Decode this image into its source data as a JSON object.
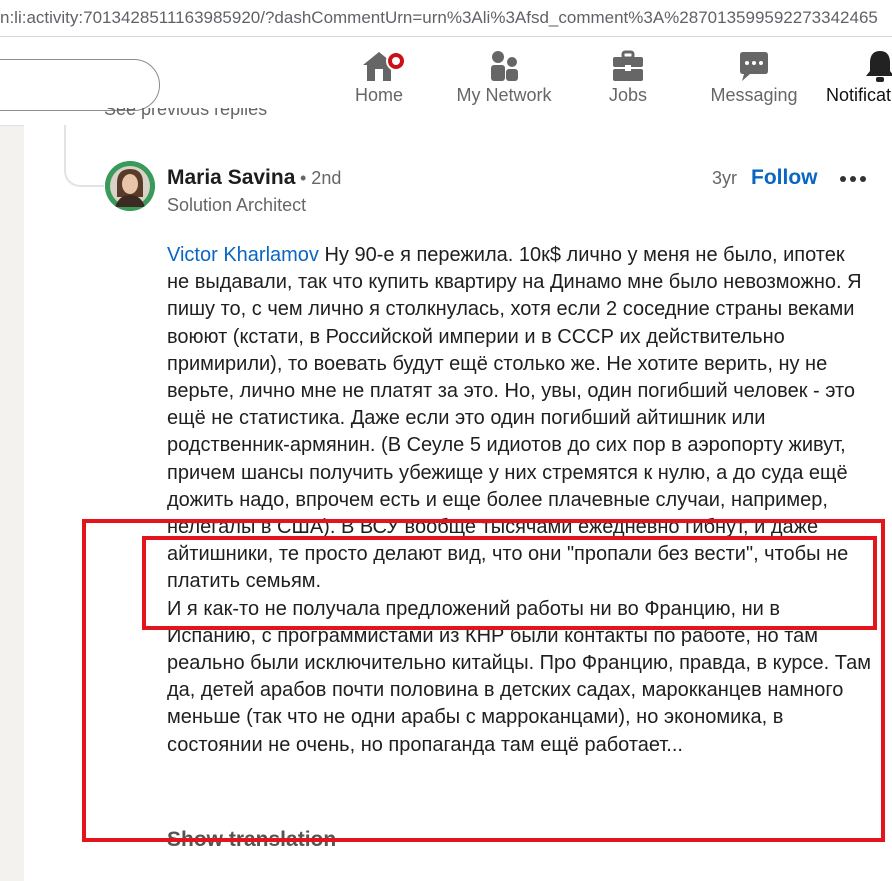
{
  "browser": {
    "url": "n:li:activity:7013428511163985920/?dashCommentUrn=urn%3Ali%3Afsd_comment%3A%287013599592273342465"
  },
  "nav": {
    "items": [
      {
        "label": "Home",
        "icon": "home-icon"
      },
      {
        "label": "My Network",
        "icon": "network-icon"
      },
      {
        "label": "Jobs",
        "icon": "briefcase-icon"
      },
      {
        "label": "Messaging",
        "icon": "messaging-icon"
      },
      {
        "label": "Notificat",
        "icon": "bell-icon"
      }
    ],
    "badge_color": "#cc1016"
  },
  "thread": {
    "see_previous": "See previous replies"
  },
  "comment": {
    "author": "Maria Savina",
    "degree": "• 2nd",
    "headline": "Solution Architect",
    "time": "3yr",
    "follow_label": "Follow",
    "more_icon": "more-icon",
    "mention": "Victor Kharlamov",
    "paragraph1": " Ну 90-е я пережила. 10к$ лично у меня не было, ипотек не выдавали, так что купить квартиру на Динамо мне было невозможно.  Я пишу то, с чем лично я столкнулась, хотя если 2 соседние страны веками воюют (кстати, в Российской империи и в СССР их действительно примирили), то воевать будут ещё столько же. Не хотите верить, ну не верьте, лично мне не платят за это. Но, увы, один погибший человек - это ещё не статистика. Даже если это один погибший айтишник или родственник-армянин. (В Сеуле 5 идиотов до сих пор в аэропорту живут, причем шансы получить убежище у них стремятся к нулю, а до суда ещё дожить надо, впрочем есть и еще более плачевные случаи, например, нелегалы в США). В ВСУ вообще тысячами ежедневно гибнут, и даже айтишники, те просто делают вид, что они \"пропали без вести\", чтобы не платить семьям.",
    "paragraph2": "И я как-то не получала предложений работы ни во Францию, ни в Испанию, с программистами из КНР были контакты по работе, но там реально были исключительно китайцы. Про Францию, правда, в курсе.  Там да, детей арабов почти половина в детских садах, марокканцев намного меньше (так что не одни арабы с марроканцами), но экономика, в состоянии не очень, но пропаганда там ещё работает...",
    "show_translation": "Show translation"
  },
  "colors": {
    "link": "#0a66c2",
    "annotation_red": "#e3141c"
  }
}
